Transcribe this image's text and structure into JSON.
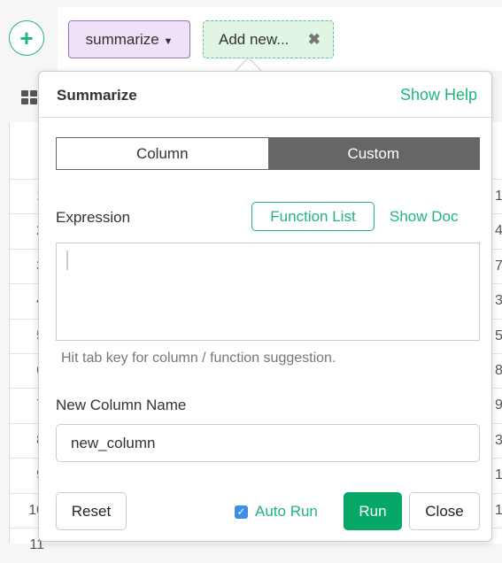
{
  "toolbar": {
    "add_icon": "+",
    "summarize_label": "summarize",
    "add_new_label": "Add new...",
    "close_glyph": "✖"
  },
  "table": {
    "rows": [
      {
        "n": "1",
        "r": "1"
      },
      {
        "n": "2",
        "r": "4"
      },
      {
        "n": "3",
        "r": "7"
      },
      {
        "n": "4",
        "r": "3"
      },
      {
        "n": "5",
        "r": "5"
      },
      {
        "n": "6",
        "r": "8"
      },
      {
        "n": "7",
        "r": "9"
      },
      {
        "n": "8",
        "r": "3"
      },
      {
        "n": "9",
        "r": "1"
      },
      {
        "n": "10",
        "r": "1"
      },
      {
        "n": "11",
        "r": ""
      }
    ]
  },
  "popover": {
    "title": "Summarize",
    "show_help": "Show Help",
    "tabs": [
      "Column",
      "Custom"
    ],
    "active_tab": "Custom",
    "expression_label": "Expression",
    "function_list": "Function List",
    "show_doc": "Show Doc",
    "expression_value": "",
    "hint": "Hit tab key for column / function suggestion.",
    "new_column_label": "New Column Name",
    "new_column_value": "new_column",
    "reset": "Reset",
    "auto_run": "Auto Run",
    "auto_run_checked": true,
    "run": "Run",
    "close": "Close"
  },
  "colors": {
    "accent": "#1fb57a",
    "summarize_bg": "#efe1f7",
    "add_new_bg": "#e1f5e4"
  }
}
